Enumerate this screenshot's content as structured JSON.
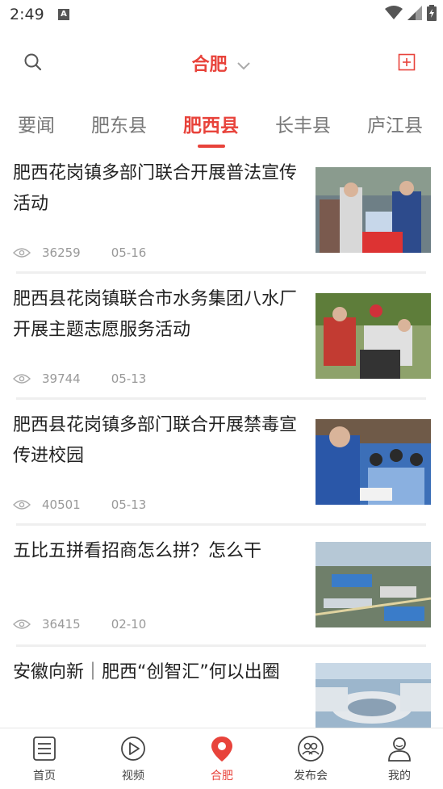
{
  "status_bar": {
    "time": "2:49",
    "notification_icon": "A"
  },
  "header": {
    "city": "合肥",
    "search_icon": "search-icon",
    "add_icon": "add-box-icon",
    "accent": "#e8433b"
  },
  "tabs": [
    {
      "label": "要闻",
      "active": false
    },
    {
      "label": "肥东县",
      "active": false
    },
    {
      "label": "肥西县",
      "active": true
    },
    {
      "label": "长丰县",
      "active": false
    },
    {
      "label": "庐江县",
      "active": false
    }
  ],
  "news": [
    {
      "title": "肥西花岗镇多部门联合开展普法宣传活动",
      "views": "36259",
      "date": "05-16"
    },
    {
      "title": "肥西县花岗镇联合市水务集团八水厂开展主题志愿服务活动",
      "views": "39744",
      "date": "05-13"
    },
    {
      "title": "肥西县花岗镇多部门联合开展禁毒宣传进校园",
      "views": "40501",
      "date": "05-13"
    },
    {
      "title": "五比五拼看招商怎么拼？怎么干",
      "views": "36415",
      "date": "02-10"
    },
    {
      "title": "安徽向新｜肥西“创智汇”何以出圈",
      "views": "",
      "date": ""
    }
  ],
  "bottom_nav": [
    {
      "label": "首页",
      "icon": "news-list-icon",
      "active": false
    },
    {
      "label": "视频",
      "icon": "play-icon",
      "active": false
    },
    {
      "label": "合肥",
      "icon": "location-pin-icon",
      "active": true
    },
    {
      "label": "发布会",
      "icon": "people-icon",
      "active": false
    },
    {
      "label": "我的",
      "icon": "user-icon",
      "active": false
    }
  ]
}
